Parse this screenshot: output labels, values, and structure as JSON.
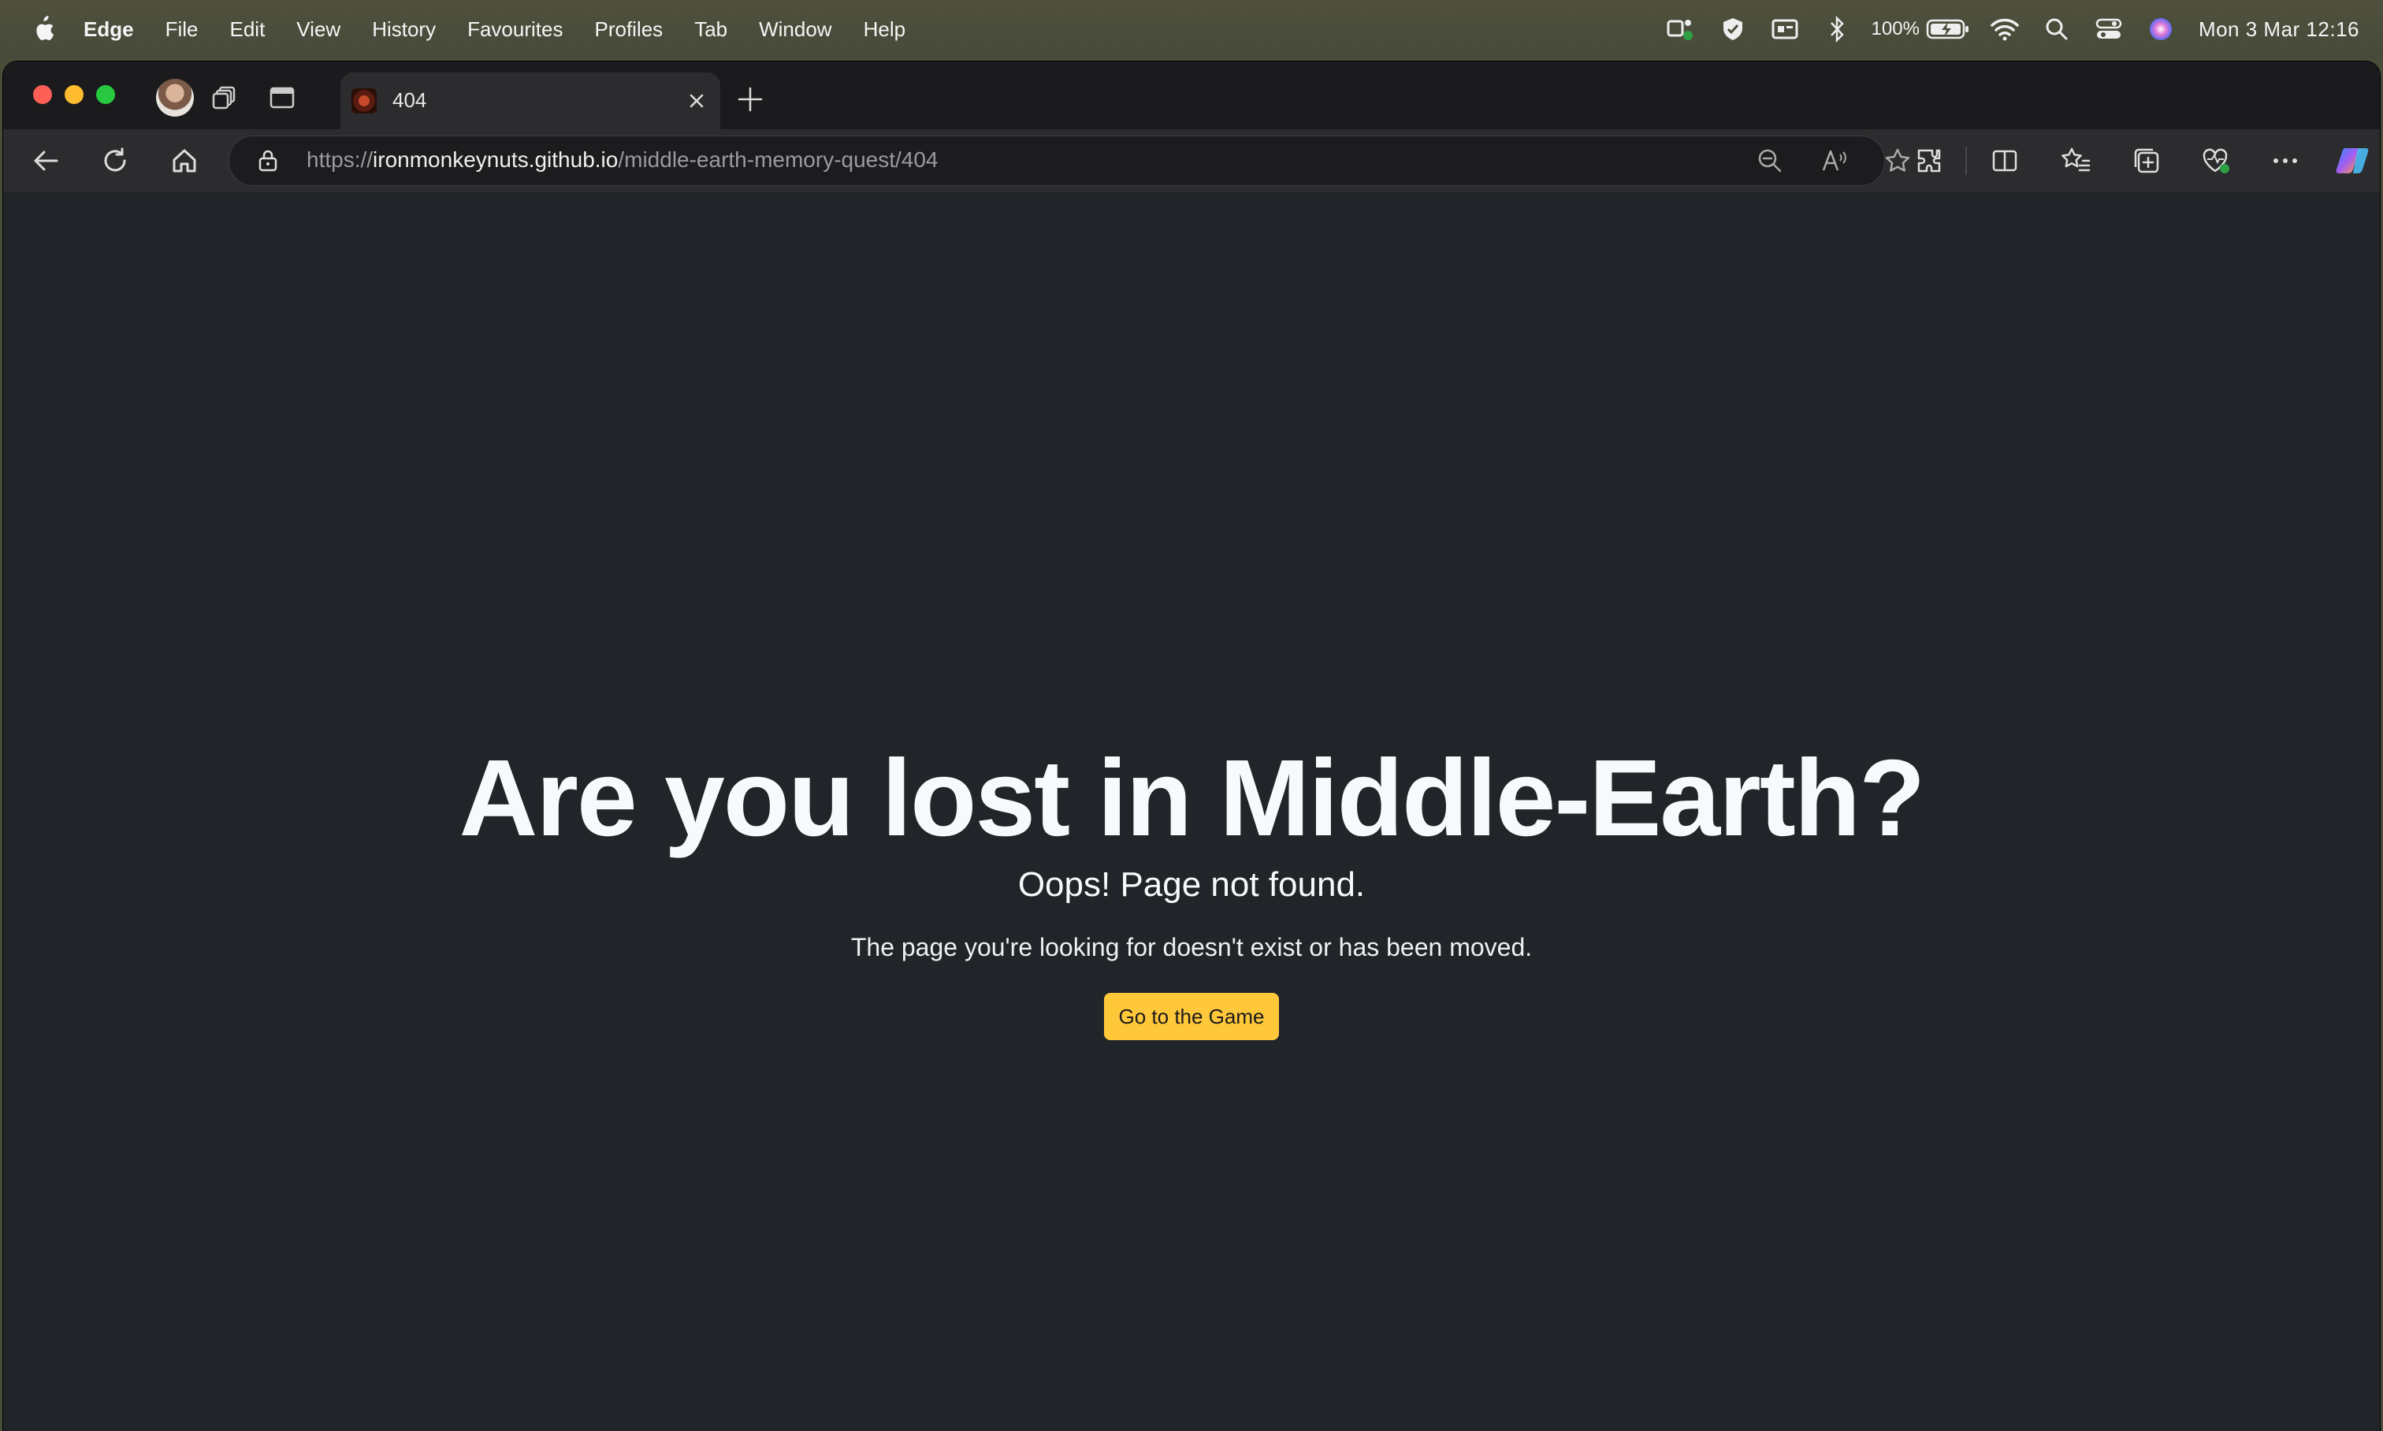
{
  "menubar": {
    "app_name": "Edge",
    "items": [
      "File",
      "Edit",
      "View",
      "History",
      "Favourites",
      "Profiles",
      "Tab",
      "Window",
      "Help"
    ],
    "battery": "100%",
    "clock": "Mon 3 Mar  12:16"
  },
  "browser": {
    "tab": {
      "title": "404"
    },
    "address": {
      "scheme": "https://",
      "host": "ironmonkeynuts.github.io",
      "path": "/middle-earth-memory-quest/404"
    }
  },
  "page": {
    "heading": "Are you lost in Middle-Earth?",
    "subheading": "Oops! Page not found.",
    "message": "The page you're looking for doesn't exist or has been moved.",
    "button_label": "Go to the Game",
    "accent_color": "#ffc73a",
    "background_color": "#212529"
  }
}
